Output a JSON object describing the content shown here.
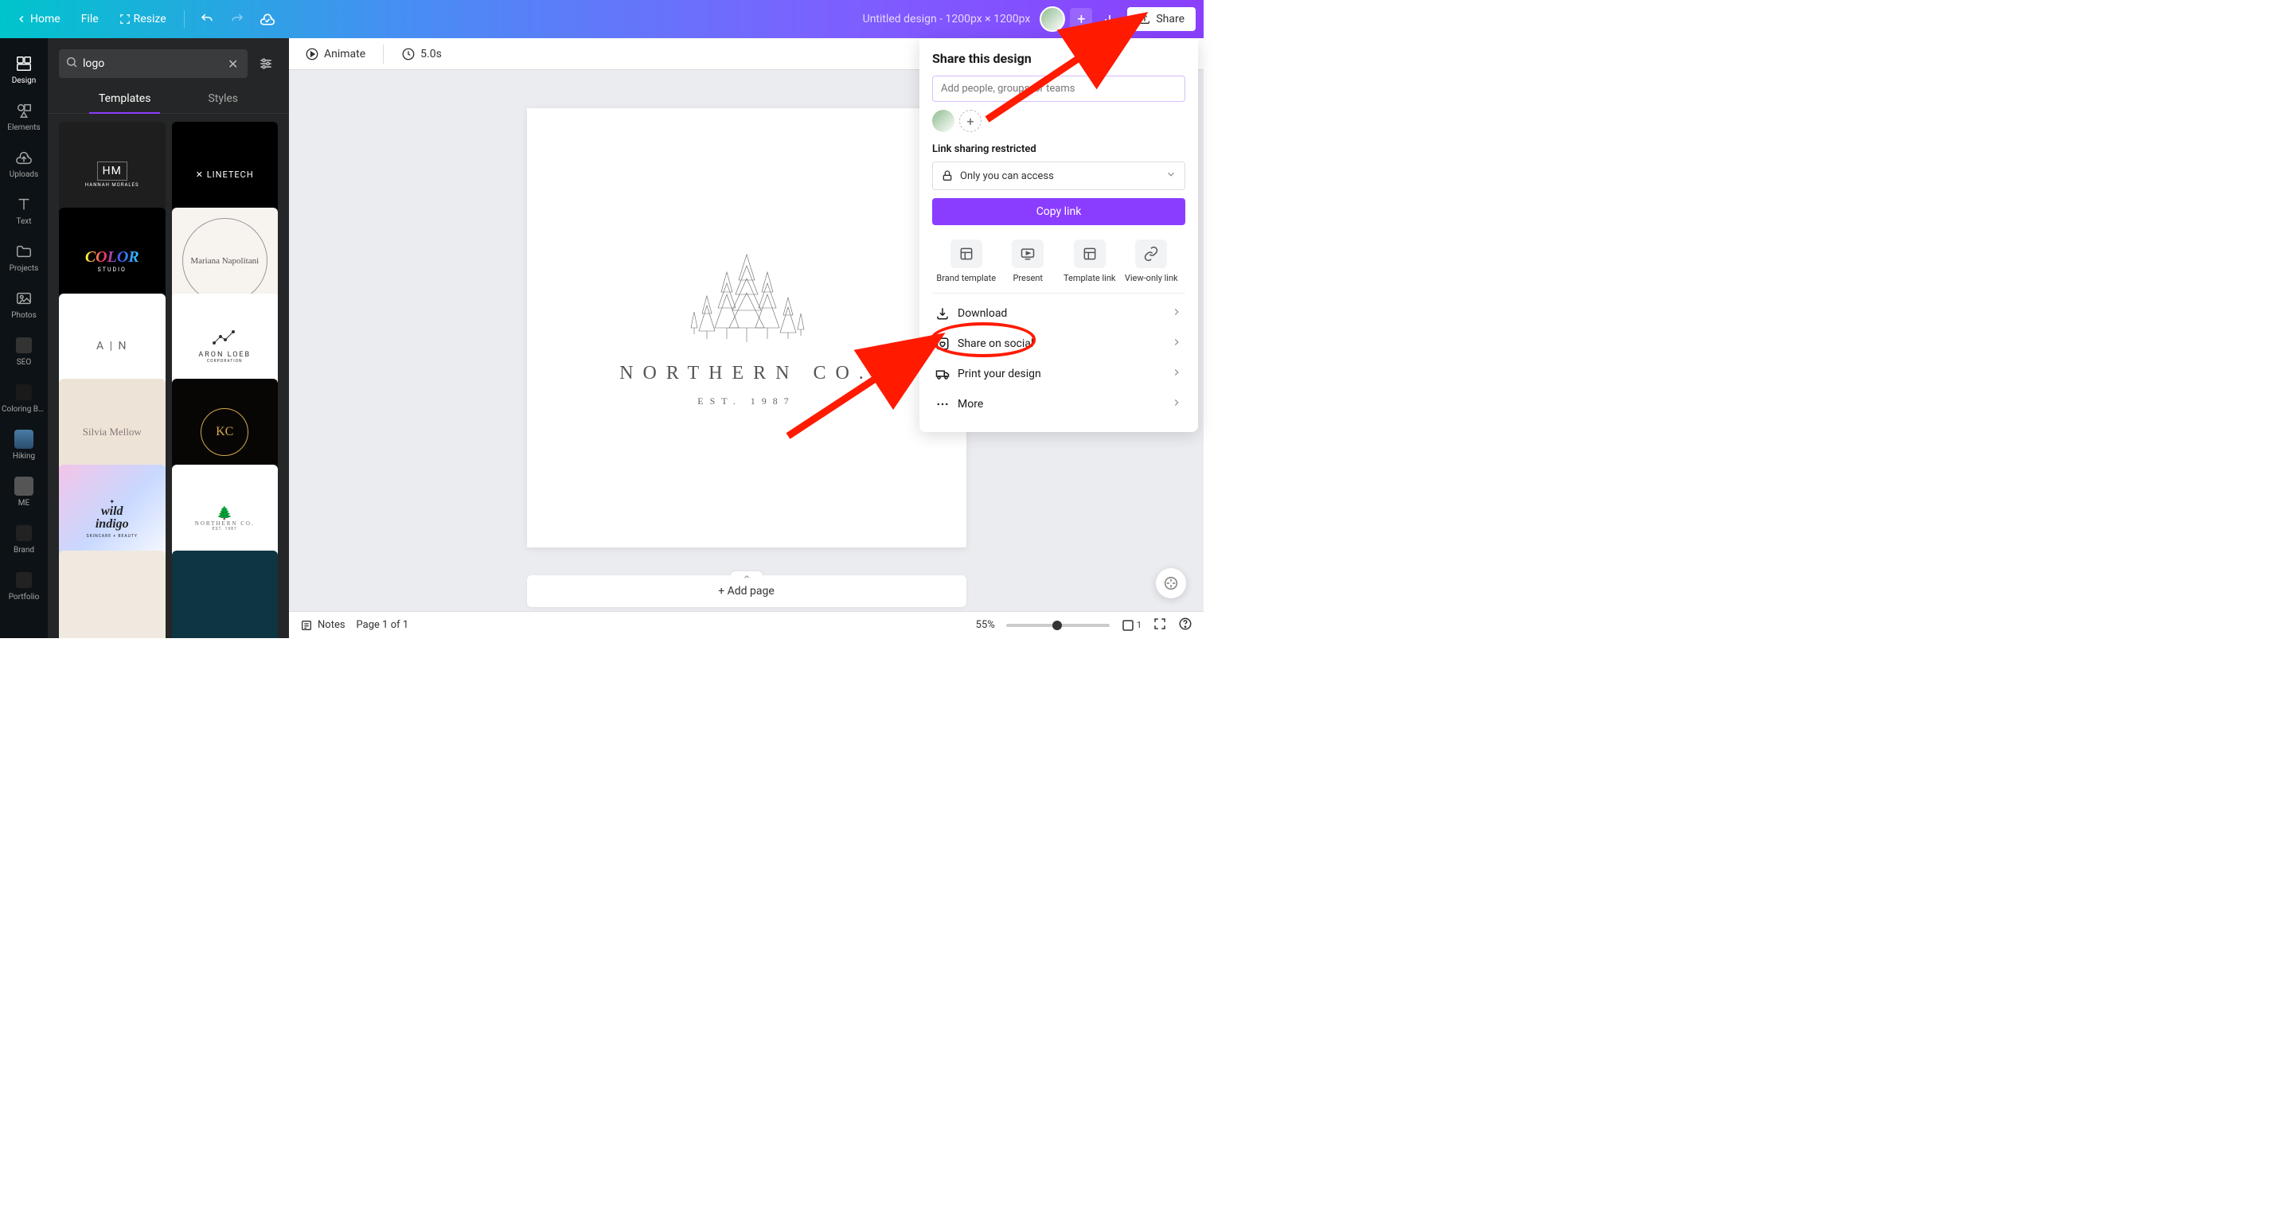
{
  "topbar": {
    "home": "Home",
    "file": "File",
    "resize": "Resize",
    "title": "Untitled design - 1200px × 1200px",
    "share": "Share"
  },
  "nav": {
    "design": "Design",
    "elements": "Elements",
    "uploads": "Uploads",
    "text": "Text",
    "projects": "Projects",
    "photos": "Photos",
    "seo": "SEO",
    "coloring": "Coloring Bo…",
    "hiking": "Hiking",
    "me": "ME",
    "brand": "Brand",
    "portfolio": "Portfolio"
  },
  "search": {
    "value": "logo",
    "tabs": {
      "templates": "Templates",
      "styles": "Styles"
    }
  },
  "templates": {
    "t1": "HANNAH MORALES",
    "t1b": "HM",
    "t2": "✕ LINETECH",
    "t3": "COLOR",
    "t3b": "STUDIO",
    "t4": "Mariana Napolitani",
    "t5": "A | N",
    "t6a": "ARON LOEB",
    "t6b": "CORPORATION",
    "t7": "Silvia Mellow",
    "t8": "KC",
    "t9a": "wild",
    "t9b": "indigo",
    "t9c": "SKINCARE + BEAUTY",
    "t10a": "NORTHERN CO.",
    "t10b": "EST. 1987"
  },
  "canvas_toolbar": {
    "animate": "Animate",
    "duration": "5.0s"
  },
  "canvas": {
    "title": "NORTHERN CO.",
    "subtitle": "EST. 1987",
    "add_page": "+ Add page"
  },
  "bottom": {
    "notes": "Notes",
    "page": "Page 1 of 1",
    "zoom": "55%",
    "pages_count": "1"
  },
  "share_panel": {
    "heading": "Share this design",
    "placeholder": "Add people, groups, or teams",
    "link_label": "Link sharing restricted",
    "access": "Only you can access",
    "copy": "Copy link",
    "grid": {
      "brand": "Brand template",
      "present": "Present",
      "template": "Template link",
      "view": "View-only link"
    },
    "list": {
      "download": "Download",
      "social": "Share on social",
      "print": "Print your design",
      "more": "More"
    }
  }
}
